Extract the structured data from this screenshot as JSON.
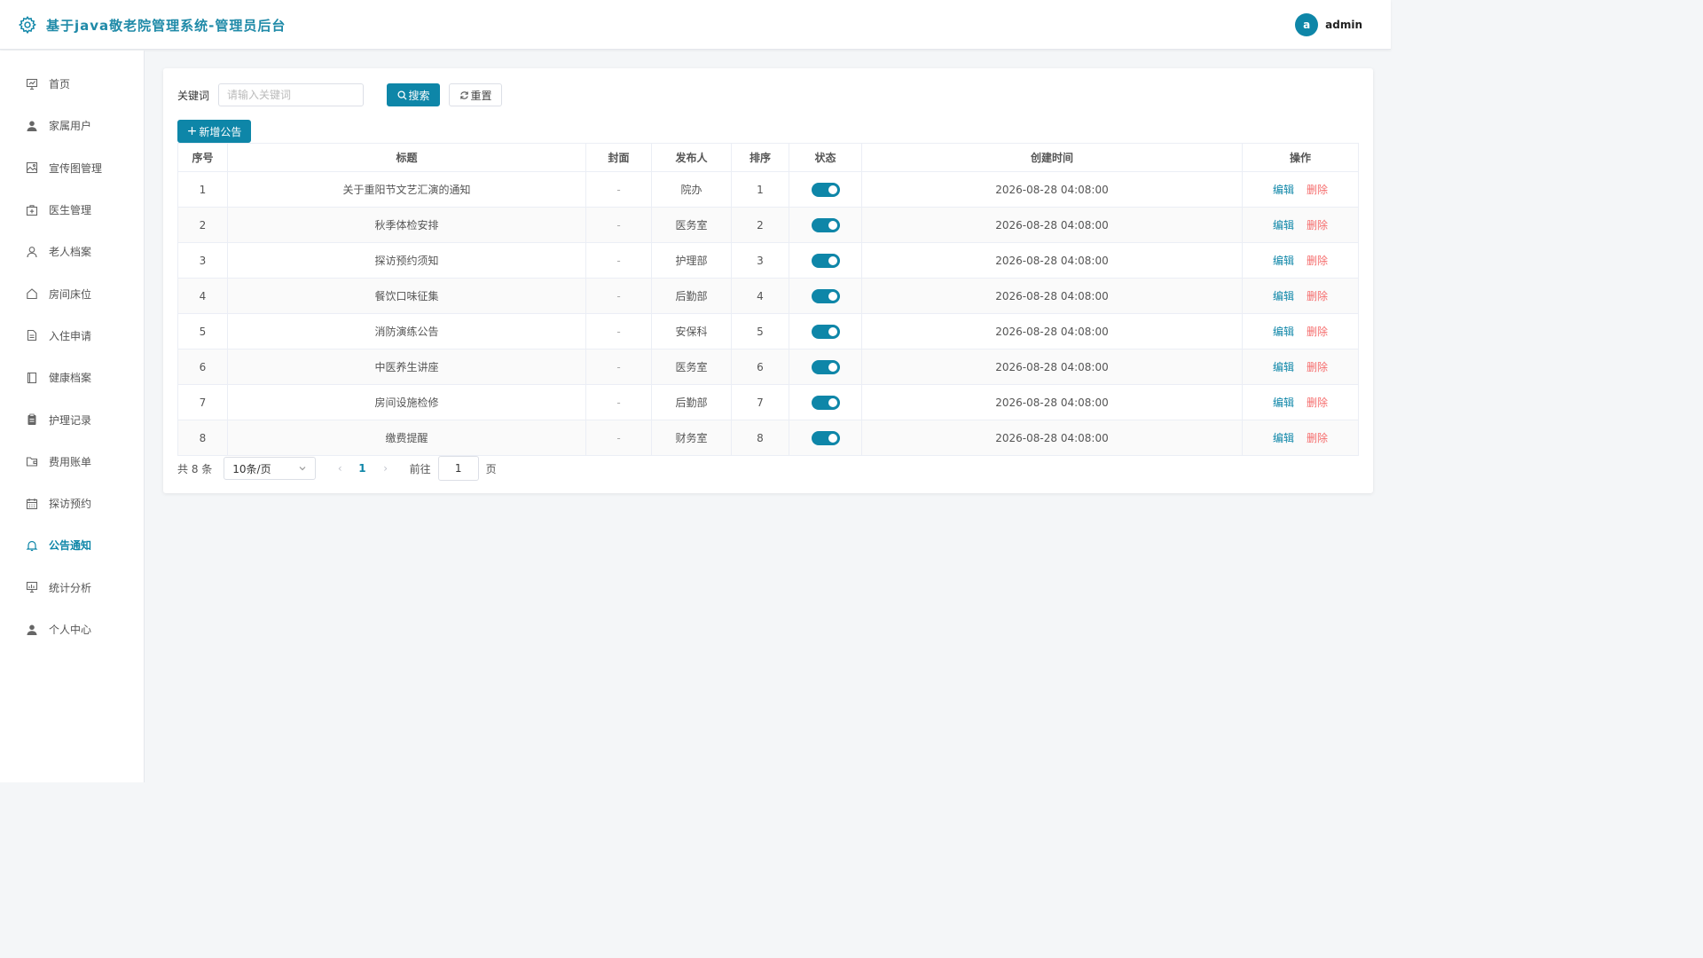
{
  "header": {
    "title": "基于java敬老院管理系统-管理员后台",
    "avatar_letter": "a",
    "username": "admin",
    "accent_color": "#0e86a8"
  },
  "sidebar": {
    "items": [
      {
        "label": "首页",
        "icon": "dashboard-icon"
      },
      {
        "label": "家属用户",
        "icon": "user-icon"
      },
      {
        "label": "宣传图管理",
        "icon": "image-icon"
      },
      {
        "label": "医生管理",
        "icon": "first-aid-icon"
      },
      {
        "label": "老人档案",
        "icon": "person-icon"
      },
      {
        "label": "房间床位",
        "icon": "home-icon"
      },
      {
        "label": "入住申请",
        "icon": "document-icon"
      },
      {
        "label": "健康档案",
        "icon": "book-icon"
      },
      {
        "label": "护理记录",
        "icon": "clipboard-icon"
      },
      {
        "label": "费用账单",
        "icon": "wallet-icon"
      },
      {
        "label": "探访预约",
        "icon": "calendar-icon"
      },
      {
        "label": "公告通知",
        "icon": "bell-icon",
        "active": true
      },
      {
        "label": "统计分析",
        "icon": "chart-icon"
      },
      {
        "label": "个人中心",
        "icon": "user-icon"
      }
    ]
  },
  "search": {
    "label": "关键词",
    "placeholder": "请输入关键词",
    "value": "",
    "search_button": "搜索",
    "reset_button": "重置"
  },
  "toolbar": {
    "add_button": "新增公告"
  },
  "table": {
    "columns": [
      "序号",
      "标题",
      "封面",
      "发布人",
      "排序",
      "状态",
      "创建时间",
      "操作"
    ],
    "rows": [
      {
        "no": "1",
        "title": "关于重阳节文艺汇演的通知",
        "cover": "-",
        "publisher": "院办",
        "sort": "1",
        "status": true,
        "created": "2026-08-28 04:08:00"
      },
      {
        "no": "2",
        "title": "秋季体检安排",
        "cover": "-",
        "publisher": "医务室",
        "sort": "2",
        "status": true,
        "created": "2026-08-28 04:08:00"
      },
      {
        "no": "3",
        "title": "探访预约须知",
        "cover": "-",
        "publisher": "护理部",
        "sort": "3",
        "status": true,
        "created": "2026-08-28 04:08:00"
      },
      {
        "no": "4",
        "title": "餐饮口味征集",
        "cover": "-",
        "publisher": "后勤部",
        "sort": "4",
        "status": true,
        "created": "2026-08-28 04:08:00"
      },
      {
        "no": "5",
        "title": "消防演练公告",
        "cover": "-",
        "publisher": "安保科",
        "sort": "5",
        "status": true,
        "created": "2026-08-28 04:08:00"
      },
      {
        "no": "6",
        "title": "中医养生讲座",
        "cover": "-",
        "publisher": "医务室",
        "sort": "6",
        "status": true,
        "created": "2026-08-28 04:08:00"
      },
      {
        "no": "7",
        "title": "房间设施检修",
        "cover": "-",
        "publisher": "后勤部",
        "sort": "7",
        "status": true,
        "created": "2026-08-28 04:08:00"
      },
      {
        "no": "8",
        "title": "缴费提醒",
        "cover": "-",
        "publisher": "财务室",
        "sort": "8",
        "status": true,
        "created": "2026-08-28 04:08:00"
      }
    ],
    "edit_label": "编辑",
    "delete_label": "删除"
  },
  "pagination": {
    "total_text": "共 8 条",
    "page_size": "10条/页",
    "current_page": "1",
    "goto_label": "前往",
    "goto_value": "1",
    "page_suffix": "页"
  }
}
